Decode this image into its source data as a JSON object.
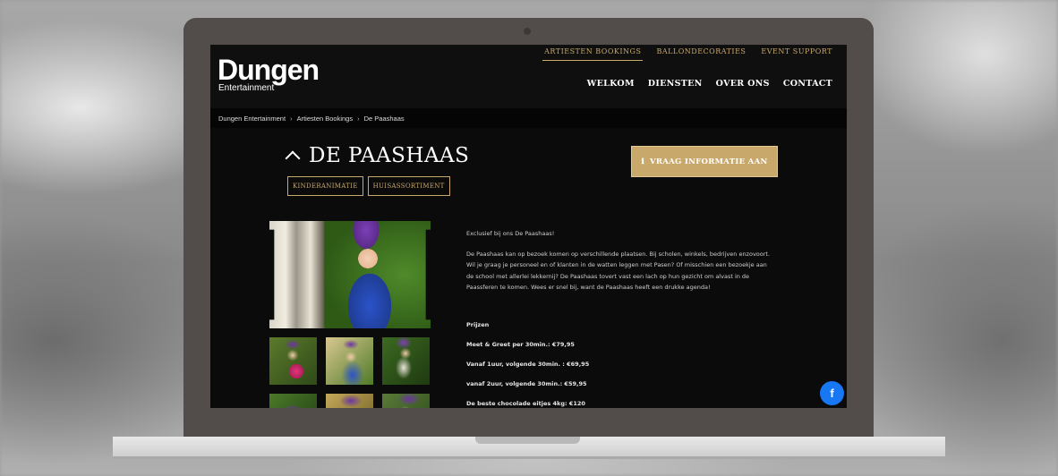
{
  "site": {
    "logo_main": "Dungen",
    "logo_sub": "Entertainment"
  },
  "topnav": [
    "ARTIESTEN BOOKINGS",
    "BALLONDECORATIES",
    "EVENT SUPPORT"
  ],
  "mainnav": [
    "WELKOM",
    "DIENSTEN",
    "OVER ONS",
    "CONTACT"
  ],
  "breadcrumb": [
    "Dungen Entertainment",
    "Artiesten Bookings",
    "De Paashaas"
  ],
  "page": {
    "title": "DE PAASHAAS",
    "tags": [
      "KINDERANIMATIE",
      "HUISASSORTIMENT"
    ],
    "cta_label": "VRAAG INFORMATIE AAN",
    "intro": "Exclusief bij ons De Paashaas!",
    "body": "De Paashaas kan op bezoek komen op verschillende plaatsen. Bij scholen, winkels, bedrijven enzovoort. Wil je graag je personeel en of klanten in de watten leggen met Pasen? Of misschien een bezoekje aan de school met allerlei lekkernij? De Paashaas tovert vast een lach op hun gezicht om alvast in de Paassferen te komen. Wees er snel bij, want de Paashaas heeft een drukke agenda!",
    "prices_heading": "Prijzen",
    "prices": [
      "Meet & Greet per 30min.: €79,95",
      "Vanaf 1uur, volgende 30min. : €69,95",
      "vanaf 2uur, volgende 30min.: €59,95",
      "De beste chocolade eitjes 4kg: €120"
    ]
  },
  "icons": {
    "cta": "info-icon",
    "social": "facebook-icon",
    "title": "chevron-up-icon"
  },
  "colors": {
    "accent": "#c9a96b",
    "facebook": "#1877f2"
  }
}
